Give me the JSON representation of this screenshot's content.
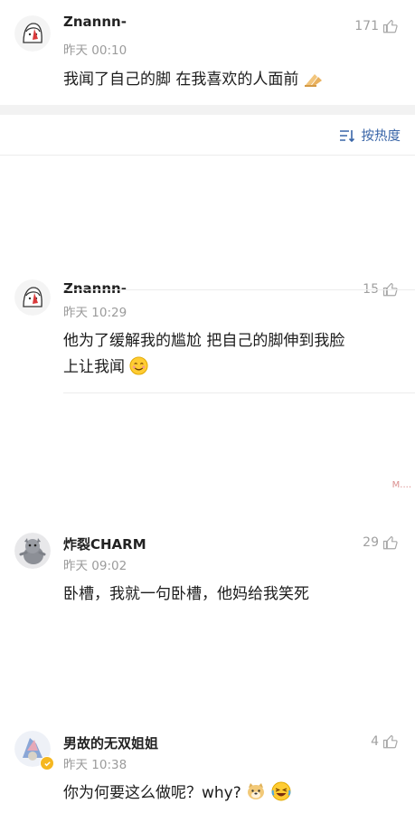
{
  "top_comment": {
    "name": "Znannn-",
    "time": "昨天 00:10",
    "likes": "171",
    "text": "我闻了自己的脚 在我喜欢的人面前"
  },
  "sort": {
    "label": "按热度",
    "icon": "sort-icon"
  },
  "comments": [
    {
      "name": "Znannn-",
      "time": "昨天 10:29",
      "likes": "15",
      "line1": "他为了缓解我的尴尬 把自己的脚伸到我脸",
      "line2": "上让我闻"
    },
    {
      "name": "炸裂CHARM",
      "time": "昨天 09:02",
      "likes": "29",
      "line1": "卧槽，我就一句卧槽，他妈给我笑死"
    },
    {
      "name": "男故的无双姐姐",
      "time": "昨天 10:38",
      "likes": "4",
      "line1": "你为何要这么做呢？why?"
    }
  ],
  "watermark": "M...."
}
